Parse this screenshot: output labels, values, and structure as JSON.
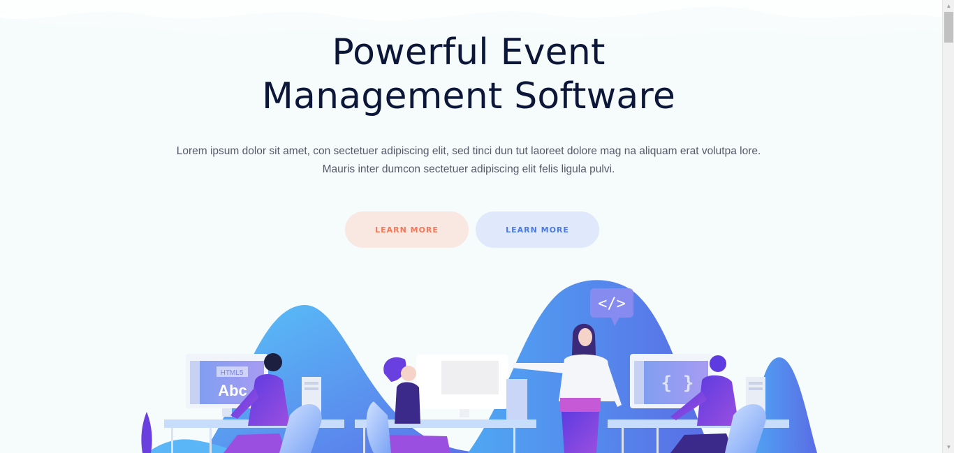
{
  "hero": {
    "title_line1": "Powerful Event",
    "title_line2": "Management Software",
    "desc_line1": "Lorem ipsum dolor sit amet, con sectetuer adipiscing elit, sed tinci dun tut laoreet dolore mag na aliquam erat volutpa lore.",
    "desc_line2": "Mauris inter dumcon sectetuer adipiscing elit felis ligula pulvi."
  },
  "buttons": {
    "primary_label": "LEARN MORE",
    "secondary_label": "LEARN MORE"
  },
  "illustration": {
    "monitor_left_tag": "HTML5",
    "monitor_left_text": "Abc",
    "speech_bubble_symbol": "</>",
    "monitor_right_symbol": "{ }"
  },
  "colors": {
    "title": "#0b1638",
    "primary_button_bg": "#f9e7e2",
    "primary_button_text": "#f27858",
    "secondary_button_bg": "#dfe9fb",
    "secondary_button_text": "#4a7ae6",
    "illustration_blue": "#5b8ef0",
    "illustration_purple": "#6a3fe0"
  }
}
